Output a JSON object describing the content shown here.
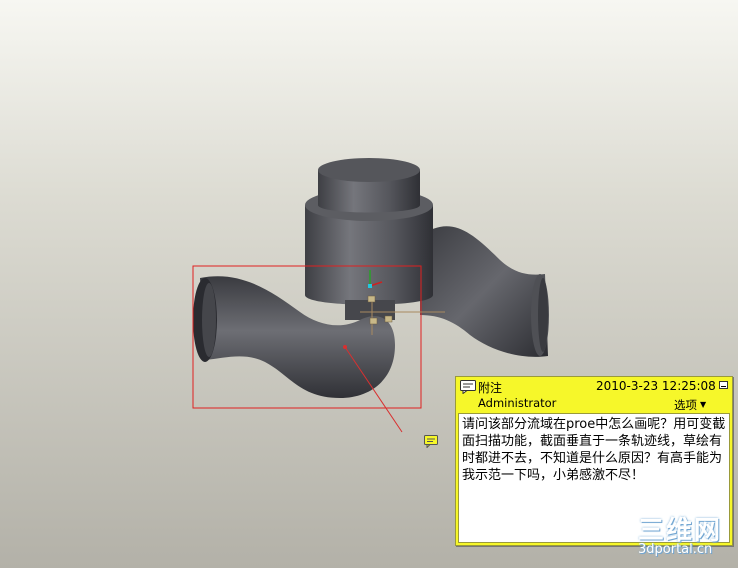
{
  "note": {
    "title": "附注",
    "datetime": "2010-3-23 12:25:08",
    "author": "Administrator",
    "options_label": "选项",
    "body": "请问该部分流域在proe中怎么画呢？用可变截面扫描功能，截面垂直于一条轨迹线，草绘有时都进不去，不知道是什么原因？有高手能为我示范一下吗，小弟感激不尽！"
  },
  "watermark": {
    "brand": "三维网",
    "site": "3dportal.cn"
  },
  "icons": [
    "note-icon",
    "minimize-icon",
    "dropdown-caret-icon",
    "note-marker-icon",
    "coordinate-axis-icon"
  ]
}
